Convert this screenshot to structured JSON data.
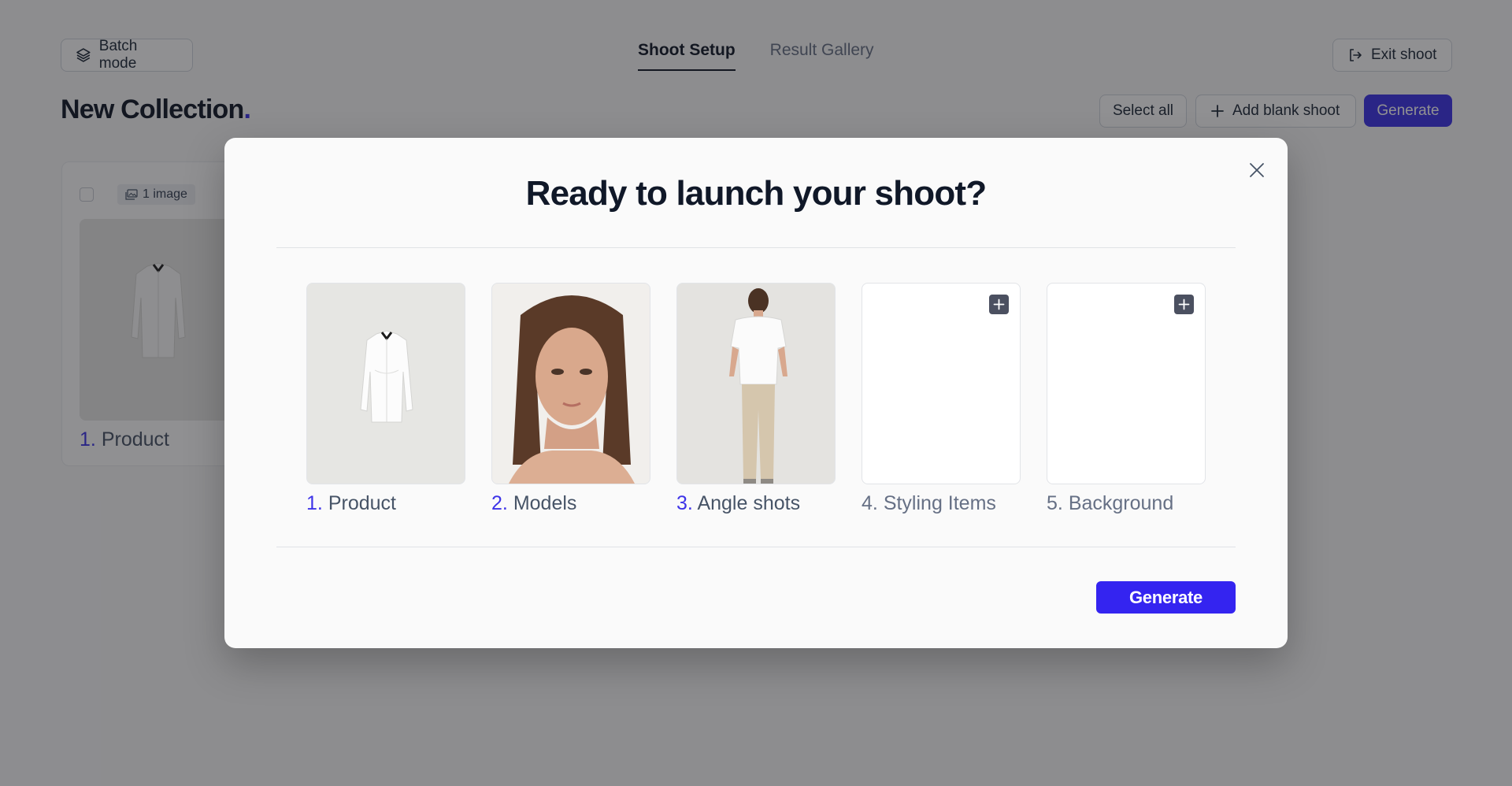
{
  "header": {
    "batch_mode_label": "Batch mode",
    "tabs": [
      {
        "label": "Shoot Setup",
        "active": true
      },
      {
        "label": "Result Gallery",
        "active": false
      }
    ],
    "exit_label": "Exit shoot"
  },
  "collection": {
    "title": "New Collection",
    "title_dot": ".",
    "select_all_label": "Select all",
    "add_blank_label": "Add blank shoot",
    "generate_label": "Generate"
  },
  "shoot_card": {
    "image_count": "1 image",
    "label_number": "1.",
    "label_text": "Product"
  },
  "modal": {
    "title": "Ready to launch your shoot?",
    "steps": [
      {
        "number": "1.",
        "label": "Product",
        "image": "white-shirt-product",
        "filled": true
      },
      {
        "number": "2.",
        "label": "Models",
        "image": "model-portrait",
        "filled": true
      },
      {
        "number": "3.",
        "label": "Angle shots",
        "image": "model-back-view",
        "filled": true
      },
      {
        "number": "4.",
        "label": "Styling Items",
        "filled": false
      },
      {
        "number": "5.",
        "label": "Background",
        "filled": false
      }
    ],
    "generate_label": "Generate"
  },
  "colors": {
    "accent": "#3d33e8",
    "modal_button": "#3424f0",
    "text_primary": "#101828",
    "text_muted": "#475467"
  }
}
